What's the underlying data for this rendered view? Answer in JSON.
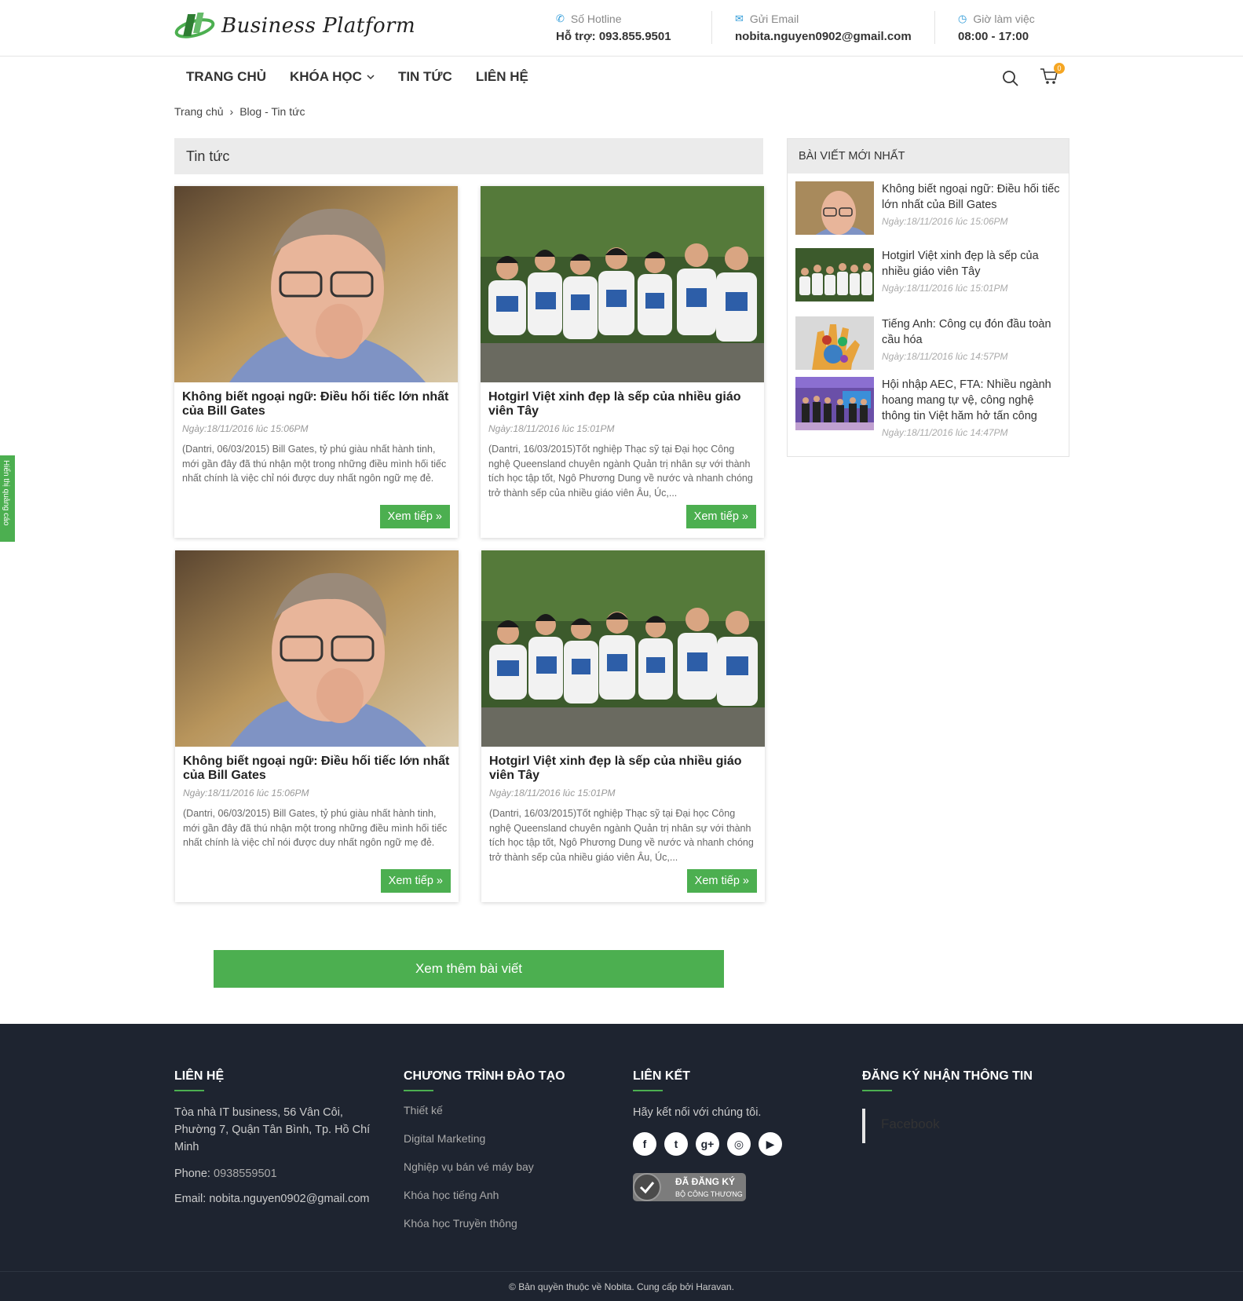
{
  "header": {
    "brand": "Business Platform",
    "hotline_label": "Số Hotline",
    "hotline_value": "Hỗ trợ: 093.855.9501",
    "email_label": "Gửi Email",
    "email_value": "nobita.nguyen0902@gmail.com",
    "hours_label": "Giờ làm việc",
    "hours_value": "08:00 - 17:00"
  },
  "nav": {
    "items": [
      "TRANG CHỦ",
      "KHÓA HỌC",
      "TIN TỨC",
      "LIÊN HỆ"
    ],
    "cart_count": "0"
  },
  "breadcrumb": {
    "home": "Trang chủ",
    "current": "Blog - Tin tức"
  },
  "main": {
    "title": "Tin tức",
    "posts": [
      {
        "title": "Không biết ngoại ngữ: Điều hối tiếc lớn nhất của Bill Gates",
        "date": "Ngày:18/11/2016 lúc 15:06PM",
        "excerpt": "(Dantri, 06/03/2015) Bill Gates, tỷ phú giàu nhất hành tinh, mới gần đây đã thú nhận một trong những điều mình hối tiếc nhất chính là việc chỉ nói được duy nhất ngôn ngữ mẹ đẻ.",
        "more": "Xem tiếp"
      },
      {
        "title": "Hotgirl Việt xinh đẹp là sếp của nhiều giáo viên Tây",
        "date": "Ngày:18/11/2016 lúc 15:01PM",
        "excerpt": "(Dantri, 16/03/2015)Tốt nghiệp Thạc sỹ tại Đại học Công nghệ Queensland chuyên ngành Quản trị nhân sự với thành tích học tập tốt, Ngô Phương Dung về nước và nhanh chóng trở thành sếp của nhiều giáo viên Âu, Úc,...",
        "more": "Xem tiếp"
      },
      {
        "title": "Không biết ngoại ngữ: Điều hối tiếc lớn nhất của Bill Gates",
        "date": "Ngày:18/11/2016 lúc 15:06PM",
        "excerpt": "(Dantri, 06/03/2015) Bill Gates, tỷ phú giàu nhất hành tinh, mới gần đây đã thú nhận một trong những điều mình hối tiếc nhất chính là việc chỉ nói được duy nhất ngôn ngữ mẹ đẻ.",
        "more": "Xem tiếp"
      },
      {
        "title": "Hotgirl Việt xinh đẹp là sếp của nhiều giáo viên Tây",
        "date": "Ngày:18/11/2016 lúc 15:01PM",
        "excerpt": "(Dantri, 16/03/2015)Tốt nghiệp Thạc sỹ tại Đại học Công nghệ Queensland chuyên ngành Quản trị nhân sự với thành tích học tập tốt, Ngô Phương Dung về nước và nhanh chóng trở thành sếp của nhiều giáo viên Âu, Úc,...",
        "more": "Xem tiếp"
      }
    ],
    "load_more": "Xem thêm bài viết"
  },
  "sidebar": {
    "title": "BÀI VIẾT MỚI NHẤT",
    "items": [
      {
        "title": "Không biết ngoại ngữ: Điều hối tiếc lớn nhất của Bill Gates",
        "date": "Ngày:18/11/2016 lúc 15:06PM"
      },
      {
        "title": "Hotgirl Việt xinh đẹp là sếp của nhiều giáo viên Tây",
        "date": "Ngày:18/11/2016 lúc 15:01PM"
      },
      {
        "title": "Tiếng Anh: Công cụ đón đầu toàn cầu hóa",
        "date": "Ngày:18/11/2016 lúc 14:57PM"
      },
      {
        "title": "Hội nhập AEC, FTA: Nhiều ngành hoang mang tự vệ, công nghệ thông tin Việt hăm hở tấn công",
        "date": "Ngày:18/11/2016 lúc 14:47PM"
      }
    ]
  },
  "ad_tab": "Hiển thị quảng cáo",
  "footer": {
    "contact_title": "LIÊN HỆ",
    "address": "Tòa nhà IT business, 56 Vân Côi, Phường 7, Quận Tân Bình, Tp. Hồ Chí Minh",
    "phone_label": "Phone:",
    "phone": "0938559501",
    "email_label": "Email:",
    "email": "nobita.nguyen0902@gmail.com",
    "programs_title": "CHƯƠNG TRÌNH ĐÀO TẠO",
    "programs": [
      "Thiết kế",
      "Digital Marketing",
      "Nghiệp vụ bán vé máy bay",
      "Khóa học tiếng Anh",
      "Khóa học Truyền thông"
    ],
    "links_title": "LIÊN KẾT",
    "links_text": "Hãy kết nối với chúng tôi.",
    "badge_line1": "ĐÃ ĐĂNG KÝ",
    "badge_line2": "BỘ CÔNG THƯƠNG",
    "subscribe_title": "ĐĂNG KÝ NHẬN THÔNG TIN",
    "facebook": "Facebook",
    "copyright": "© Bản quyền thuộc về Nobita. Cung cấp bởi Haravan."
  },
  "colors": {
    "accent": "#4caf50",
    "footer_bg": "#1e2430",
    "info_icon": "#2d9ad8",
    "badge": "#f5a623"
  }
}
